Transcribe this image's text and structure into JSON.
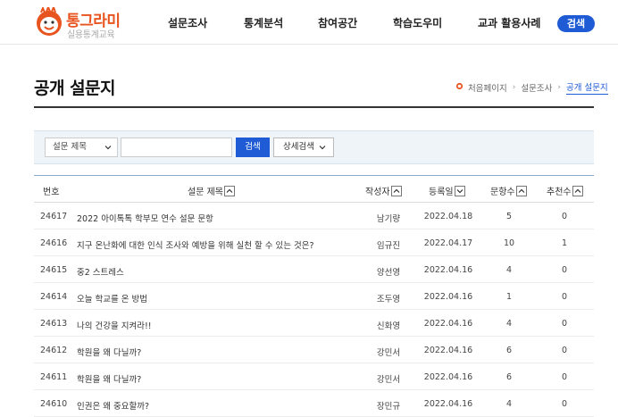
{
  "brand": {
    "title": "통그라미",
    "subtitle": "실용통계교육",
    "color": "#e8541f"
  },
  "nav": {
    "items": [
      "설문조사",
      "통계분석",
      "참여공간",
      "학습도우미",
      "교과 활용사례"
    ],
    "search_label": "검색"
  },
  "page": {
    "title": "공개 설문지"
  },
  "breadcrumb": {
    "home": "처음페이지",
    "level1": "설문조사",
    "current": "공개 설문지"
  },
  "search": {
    "select_value": "설문 제목",
    "input_value": "",
    "input_placeholder": "",
    "search_label": "검색",
    "detail_label": "상세검색"
  },
  "table": {
    "headers": {
      "num": "번호",
      "title": "설문 제목",
      "author": "작성자",
      "date": "등록일",
      "count": "문항수",
      "rec": "추천수"
    },
    "rows": [
      {
        "num": "24617",
        "title": "2022 아이톡톡 학부모 연수 설문 문항",
        "author": "남기량",
        "date": "2022.04.18",
        "count": "5",
        "rec": "0"
      },
      {
        "num": "24616",
        "title": "지구 온난화에 대한 인식 조사와 예방을 위해 실천 할 수 있는 것은?",
        "author": "임규진",
        "date": "2022.04.17",
        "count": "10",
        "rec": "1"
      },
      {
        "num": "24615",
        "title": "중2 스트레스",
        "author": "양선영",
        "date": "2022.04.16",
        "count": "4",
        "rec": "0"
      },
      {
        "num": "24614",
        "title": "오늘 학교를 온 방법",
        "author": "조두영",
        "date": "2022.04.16",
        "count": "1",
        "rec": "0"
      },
      {
        "num": "24613",
        "title": "나의 건강을 지켜라!!",
        "author": "신화영",
        "date": "2022.04.16",
        "count": "4",
        "rec": "0"
      },
      {
        "num": "24612",
        "title": "학원을 왜 다닐까?",
        "author": "강민서",
        "date": "2022.04.16",
        "count": "6",
        "rec": "0"
      },
      {
        "num": "24611",
        "title": "학원을 왜 다닐까?",
        "author": "강민서",
        "date": "2022.04.16",
        "count": "6",
        "rec": "0"
      },
      {
        "num": "24610",
        "title": "인권은 왜 중요할까?",
        "author": "장민규",
        "date": "2022.04.16",
        "count": "4",
        "rec": "0"
      }
    ]
  },
  "colors": {
    "accent": "#1f5bd4",
    "panel_bg": "#eef4f8"
  }
}
